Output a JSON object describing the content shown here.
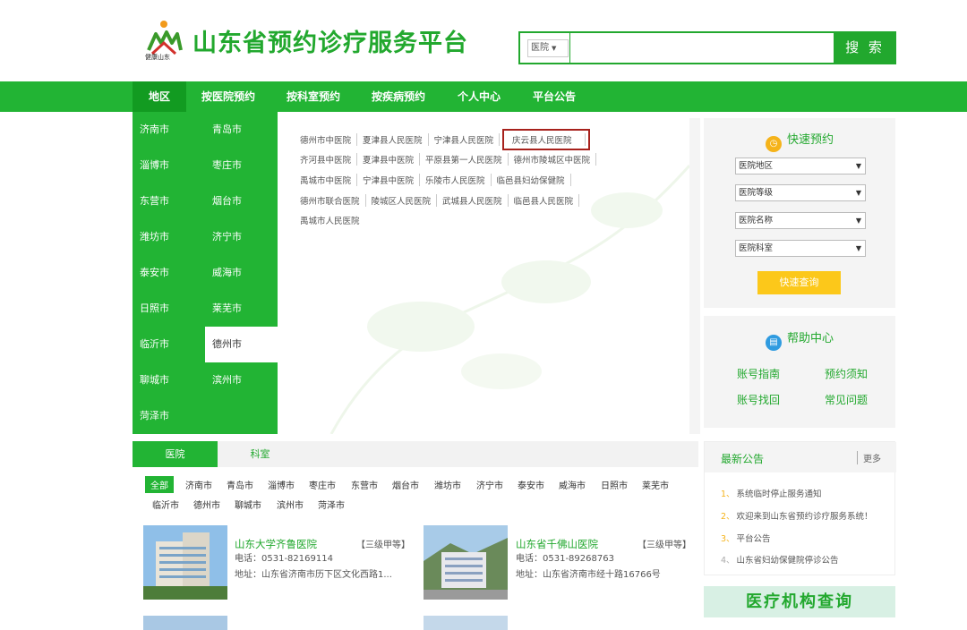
{
  "header": {
    "title": "山东省预约诊疗服务平台",
    "logo_text": "健康山东",
    "search": {
      "select_value": "医院",
      "placeholder": "",
      "button_label": "搜 索"
    }
  },
  "nav": {
    "items": [
      {
        "label": "地区",
        "active": true
      },
      {
        "label": "按医院预约",
        "active": false
      },
      {
        "label": "按科室预约",
        "active": false
      },
      {
        "label": "按疾病预约",
        "active": false
      },
      {
        "label": "个人中心",
        "active": false
      },
      {
        "label": "平台公告",
        "active": false
      }
    ]
  },
  "cities": [
    "济南市",
    "青岛市",
    "淄博市",
    "枣庄市",
    "东营市",
    "烟台市",
    "潍坊市",
    "济宁市",
    "泰安市",
    "威海市",
    "日照市",
    "莱芜市",
    "临沂市",
    "德州市",
    "聊城市",
    "滨州市",
    "菏泽市"
  ],
  "selected_city": "德州市",
  "hospital_rows": [
    [
      "德州市中医院",
      "夏津县人民医院",
      "宁津县人民医院",
      "庆云县人民医院"
    ],
    [
      "齐河县中医院",
      "夏津县中医院",
      "平原县第一人民医院",
      "德州市陵城区中医院"
    ],
    [
      "禹城市中医院",
      "宁津县中医院",
      "乐陵市人民医院",
      "临邑县妇幼保健院"
    ],
    [
      "德州市联合医院",
      "陵城区人民医院",
      "武城县人民医院",
      "临邑县人民医院"
    ],
    [
      "禹城市人民医院"
    ]
  ],
  "highlighted_hospital": "庆云县人民医院",
  "quick": {
    "title": "快速预约",
    "selects": [
      "医院地区",
      "医院等级",
      "医院名称",
      "医院科室"
    ],
    "button": "快速查询"
  },
  "help": {
    "title": "帮助中心",
    "links": [
      "账号指南",
      "预约须知",
      "账号找回",
      "常见问题"
    ]
  },
  "bottom": {
    "tabs": [
      "医院",
      "科室"
    ],
    "filters_row1": [
      "全部",
      "济南市",
      "青岛市",
      "淄博市",
      "枣庄市",
      "东营市",
      "烟台市",
      "潍坊市",
      "济宁市",
      "泰安市",
      "威海市",
      "日照市",
      "莱芜市"
    ],
    "filters_row2": [
      "临沂市",
      "德州市",
      "聊城市",
      "滨州市",
      "菏泽市"
    ],
    "hospitals": [
      {
        "name": "山东大学齐鲁医院",
        "grade": "【三级甲等】",
        "phone": "电话：0531-82169114",
        "address": "地址：山东省济南市历下区文化西路1..."
      },
      {
        "name": "山东省千佛山医院",
        "grade": "【三级甲等】",
        "phone": "电话：0531-89268763",
        "address": "地址：山东省济南市经十路16766号"
      }
    ]
  },
  "notices": {
    "title": "最新公告",
    "more": "更多",
    "items": [
      {
        "num": "1、",
        "text": "系统临时停止服务通知"
      },
      {
        "num": "2、",
        "text": "欢迎来到山东省预约诊疗服务系统！"
      },
      {
        "num": "3、",
        "text": "平台公告"
      },
      {
        "num": "4、",
        "text": "山东省妇幼保健院停诊公告"
      }
    ]
  },
  "org_query": "医疗机构查询",
  "colors": {
    "brand_green": "#22b434",
    "dark_green": "#129b21",
    "highlight_red": "#a7211c",
    "button_yellow": "#fcc81a"
  }
}
